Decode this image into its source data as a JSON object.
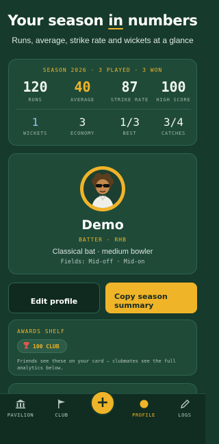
{
  "header": {
    "title_pre": "Your season ",
    "title_underlined": "in",
    "title_post": " numbers",
    "subtitle": "Runs, average, strike rate and wickets at a glance"
  },
  "stats": {
    "season_line": "SEASON 2026 · 3 PLAYED · 3 WON",
    "primary": [
      {
        "value": "120",
        "label": "RUNS"
      },
      {
        "value": "40",
        "label": "AVERAGE"
      },
      {
        "value": "87",
        "label": "STRIKE RATE"
      },
      {
        "value": "100",
        "label": "HIGH SCORE"
      }
    ],
    "secondary": [
      {
        "value": "1",
        "label": "WICKETS"
      },
      {
        "value": "3",
        "label": "ECONOMY"
      },
      {
        "value": "1/3",
        "label": "BEST"
      },
      {
        "value": "3/4",
        "label": "CATCHES"
      }
    ]
  },
  "profile": {
    "name": "Demo",
    "role": "BATTER · RHB",
    "description": "Classical bat · medium bowler",
    "fields": "Fields: Mid-off · Mid-on"
  },
  "actions": {
    "edit_label": "Edit profile",
    "copy_label_line1": "Copy season",
    "copy_label_line2": "summary"
  },
  "awards": {
    "title": "AWARDS SHELF",
    "badges": [
      {
        "label": "100 CLUB",
        "icon": "trophy-icon"
      }
    ],
    "note_line1": "Friends see these on your card — clubmates see the full",
    "note_line2": "analytics below."
  },
  "nav": {
    "items": [
      {
        "label": "PAVILION",
        "icon": "pavilion-icon"
      },
      {
        "label": "CLUB",
        "icon": "flag-icon"
      },
      {
        "label": "PROFILE",
        "icon": "profile-dot-icon"
      },
      {
        "label": "LOGS",
        "icon": "pencil-icon"
      }
    ],
    "fab_label": "+"
  },
  "colors": {
    "background": "#163a2c",
    "card": "#1f4a38",
    "accent": "#f0b429",
    "wickets": "#8ec5ea"
  }
}
